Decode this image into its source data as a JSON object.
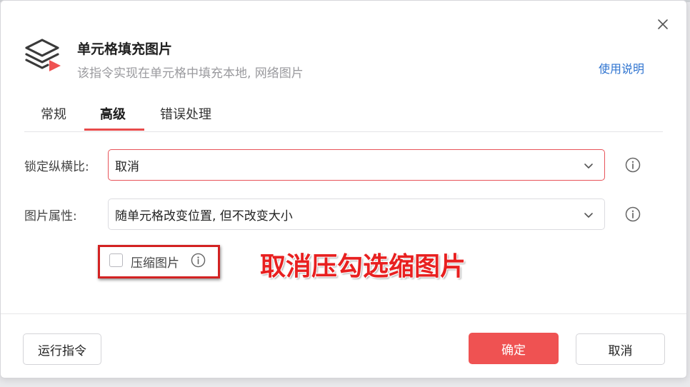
{
  "dialog": {
    "title": "单元格填充图片",
    "subtitle": "该指令实现在单元格中填充本地, 网络图片",
    "help_link": "使用说明",
    "close_icon": "close-icon",
    "header_icon": "layers-play-icon"
  },
  "tabs": [
    {
      "label": "常规",
      "active": false
    },
    {
      "label": "高级",
      "active": true
    },
    {
      "label": "错误处理",
      "active": false
    }
  ],
  "fields": {
    "lock_ratio": {
      "label": "锁定纵横比:",
      "value": "取消"
    },
    "image_property": {
      "label": "图片属性:",
      "value": "随单元格改变位置, 但不改变大小"
    },
    "compress": {
      "label": "压缩图片",
      "checked": false
    }
  },
  "annotation": "取消压勾选缩图片",
  "footer": {
    "run_label": "运行指令",
    "ok_label": "确定",
    "cancel_label": "取消"
  },
  "colors": {
    "accent": "#ef5252",
    "link": "#2f74d0",
    "annotation": "#e82020"
  }
}
